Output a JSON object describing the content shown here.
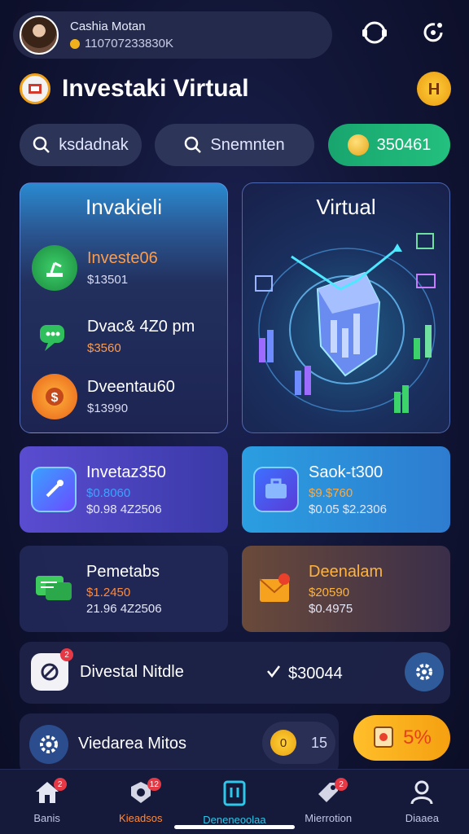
{
  "profile": {
    "name": "Cashia Motan",
    "id_line": "110707233830K"
  },
  "app": {
    "title": "Investaki Virtual"
  },
  "search_row": {
    "search1": "ksdadnak",
    "search2": "Snemnten",
    "balance": "350461"
  },
  "card_left": {
    "heading": "Invakieli",
    "items": [
      {
        "name": "Investe06",
        "value": "$13501",
        "icon": "robot-arm-icon"
      },
      {
        "name": "Dvac& 4Z0 pm",
        "value": "$3560",
        "icon": "chat-bubble-icon"
      },
      {
        "name": "Dveentau60",
        "value": "$13990",
        "icon": "dollar-gear-icon"
      }
    ]
  },
  "card_right": {
    "heading": "Virtual"
  },
  "mid_cards": [
    {
      "title": "Invetaz350",
      "v1": "$0.8060",
      "v2": "$0.98 4Z2506",
      "v1_color": "#3da2ff"
    },
    {
      "title": "Saok-t300",
      "v1": "$9.$760",
      "v2": "$0.05 $2.2306",
      "v1_color": "#ffa83a"
    },
    {
      "title": "Pemetabs",
      "v1": "$1.2450",
      "v2": "21.96 4Z2506",
      "v1_color": "#ff8a3a"
    },
    {
      "title": "Deenalam",
      "v1": "$20590",
      "v2": "$0.4975",
      "v1_color": "#ffb33a"
    }
  ],
  "row1": {
    "label": "Divestal Nitdle",
    "value": "$30044",
    "badge": "2"
  },
  "row2": {
    "label": "Viedarea Mitos",
    "toggle_left": "0",
    "toggle_right": "15",
    "percent": "5%"
  },
  "nav": [
    {
      "label": "Banis",
      "badge": "2"
    },
    {
      "label": "Kieadsos",
      "badge": "12"
    },
    {
      "label": "Deneneoolaa",
      "badge": ""
    },
    {
      "label": "Mierrotion",
      "badge": "2"
    },
    {
      "label": "Diaaea",
      "badge": ""
    }
  ],
  "colors": {
    "accent_green": "#1fb477",
    "accent_orange": "#ff8a3a",
    "accent_gold": "#f6b21e",
    "nav_active": "#2fc8e8"
  }
}
